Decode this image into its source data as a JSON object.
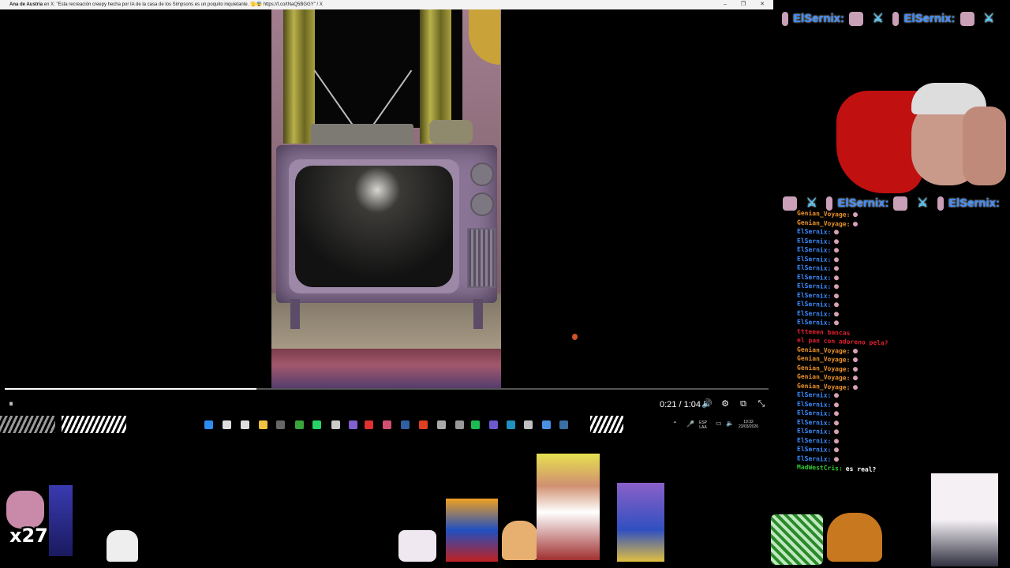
{
  "window": {
    "title_bold": "Ana de Austria",
    "title_rest": " en X: \"Esta recreación creepy hecha por IA de la casa de los Simpsons es un poquito inquietante. 🫣😨 https://t.co/tNaQ5BGGY\" / X",
    "minimize": "–",
    "restore": "❐",
    "close": "✕"
  },
  "player": {
    "time": "0:21 / 1:04",
    "progress": 0.33,
    "pause_glyph": "⏸",
    "volume_glyph": "🔊",
    "settings_glyph": "⚙",
    "popout_glyph": "⧉",
    "exit_fullscreen_glyph": "⤡"
  },
  "taskbar": {
    "icons": [
      "windows-icon",
      "search-icon",
      "task-view-icon",
      "file-explorer-icon",
      "calculator-icon",
      "xbox-icon",
      "whatsapp-icon",
      "app-icon",
      "app-icon",
      "app-icon",
      "app-icon",
      "steam-icon",
      "brave-icon",
      "app-icon",
      "app-icon",
      "spotify-icon",
      "app-icon",
      "app-icon",
      "app-icon",
      "app-icon",
      "steam-icon"
    ],
    "lang_top": "ESP",
    "lang_bottom": "LAA",
    "clock_time": "19:32",
    "clock_date": "23/03/2026"
  },
  "overlay": {
    "banner_name": "ElSernix:",
    "webcam_label": "",
    "counter": "x27"
  },
  "chat": {
    "lines": [
      {
        "user": "Genian_Voyage:",
        "color": "#e8902a",
        "text": ""
      },
      {
        "user": "Genian_Voyage:",
        "color": "#e8902a",
        "text": ""
      },
      {
        "user": "ElSernix:",
        "color": "#3a8cff",
        "text": ""
      },
      {
        "user": "ElSernix:",
        "color": "#3a8cff",
        "text": ""
      },
      {
        "user": "ElSernix:",
        "color": "#3a8cff",
        "text": ""
      },
      {
        "user": "ElSernix:",
        "color": "#3a8cff",
        "text": ""
      },
      {
        "user": "ElSernix:",
        "color": "#3a8cff",
        "text": ""
      },
      {
        "user": "ElSernix:",
        "color": "#3a8cff",
        "text": ""
      },
      {
        "user": "ElSernix:",
        "color": "#3a8cff",
        "text": ""
      },
      {
        "user": "ElSernix:",
        "color": "#3a8cff",
        "text": ""
      },
      {
        "user": "ElSernix:",
        "color": "#3a8cff",
        "text": ""
      },
      {
        "user": "ElSernix:",
        "color": "#3a8cff",
        "text": ""
      },
      {
        "user": "ElSernix:",
        "color": "#3a8cff",
        "text": ""
      },
      {
        "user": "",
        "color": "#e02030",
        "text": "ttteeen bancas"
      },
      {
        "user": "",
        "color": "#e02030",
        "text": "el pan con adoreno pela?"
      },
      {
        "user": "Genian_Voyage:",
        "color": "#e8902a",
        "text": ""
      },
      {
        "user": "Genian_Voyage:",
        "color": "#e8902a",
        "text": ""
      },
      {
        "user": "Genian_Voyage:",
        "color": "#e8902a",
        "text": ""
      },
      {
        "user": "Genian_Voyage:",
        "color": "#e8902a",
        "text": ""
      },
      {
        "user": "Genian_Voyage:",
        "color": "#e8902a",
        "text": ""
      },
      {
        "user": "ElSernix:",
        "color": "#3a8cff",
        "text": ""
      },
      {
        "user": "ElSernix:",
        "color": "#3a8cff",
        "text": ""
      },
      {
        "user": "ElSernix:",
        "color": "#3a8cff",
        "text": ""
      },
      {
        "user": "ElSernix:",
        "color": "#3a8cff",
        "text": ""
      },
      {
        "user": "ElSernix:",
        "color": "#3a8cff",
        "text": ""
      },
      {
        "user": "ElSernix:",
        "color": "#3a8cff",
        "text": ""
      },
      {
        "user": "ElSernix:",
        "color": "#3a8cff",
        "text": ""
      },
      {
        "user": "ElSernix:",
        "color": "#3a8cff",
        "text": ""
      },
      {
        "user": "MadWestCris:",
        "color": "#32c832",
        "text": "es real?"
      }
    ]
  }
}
